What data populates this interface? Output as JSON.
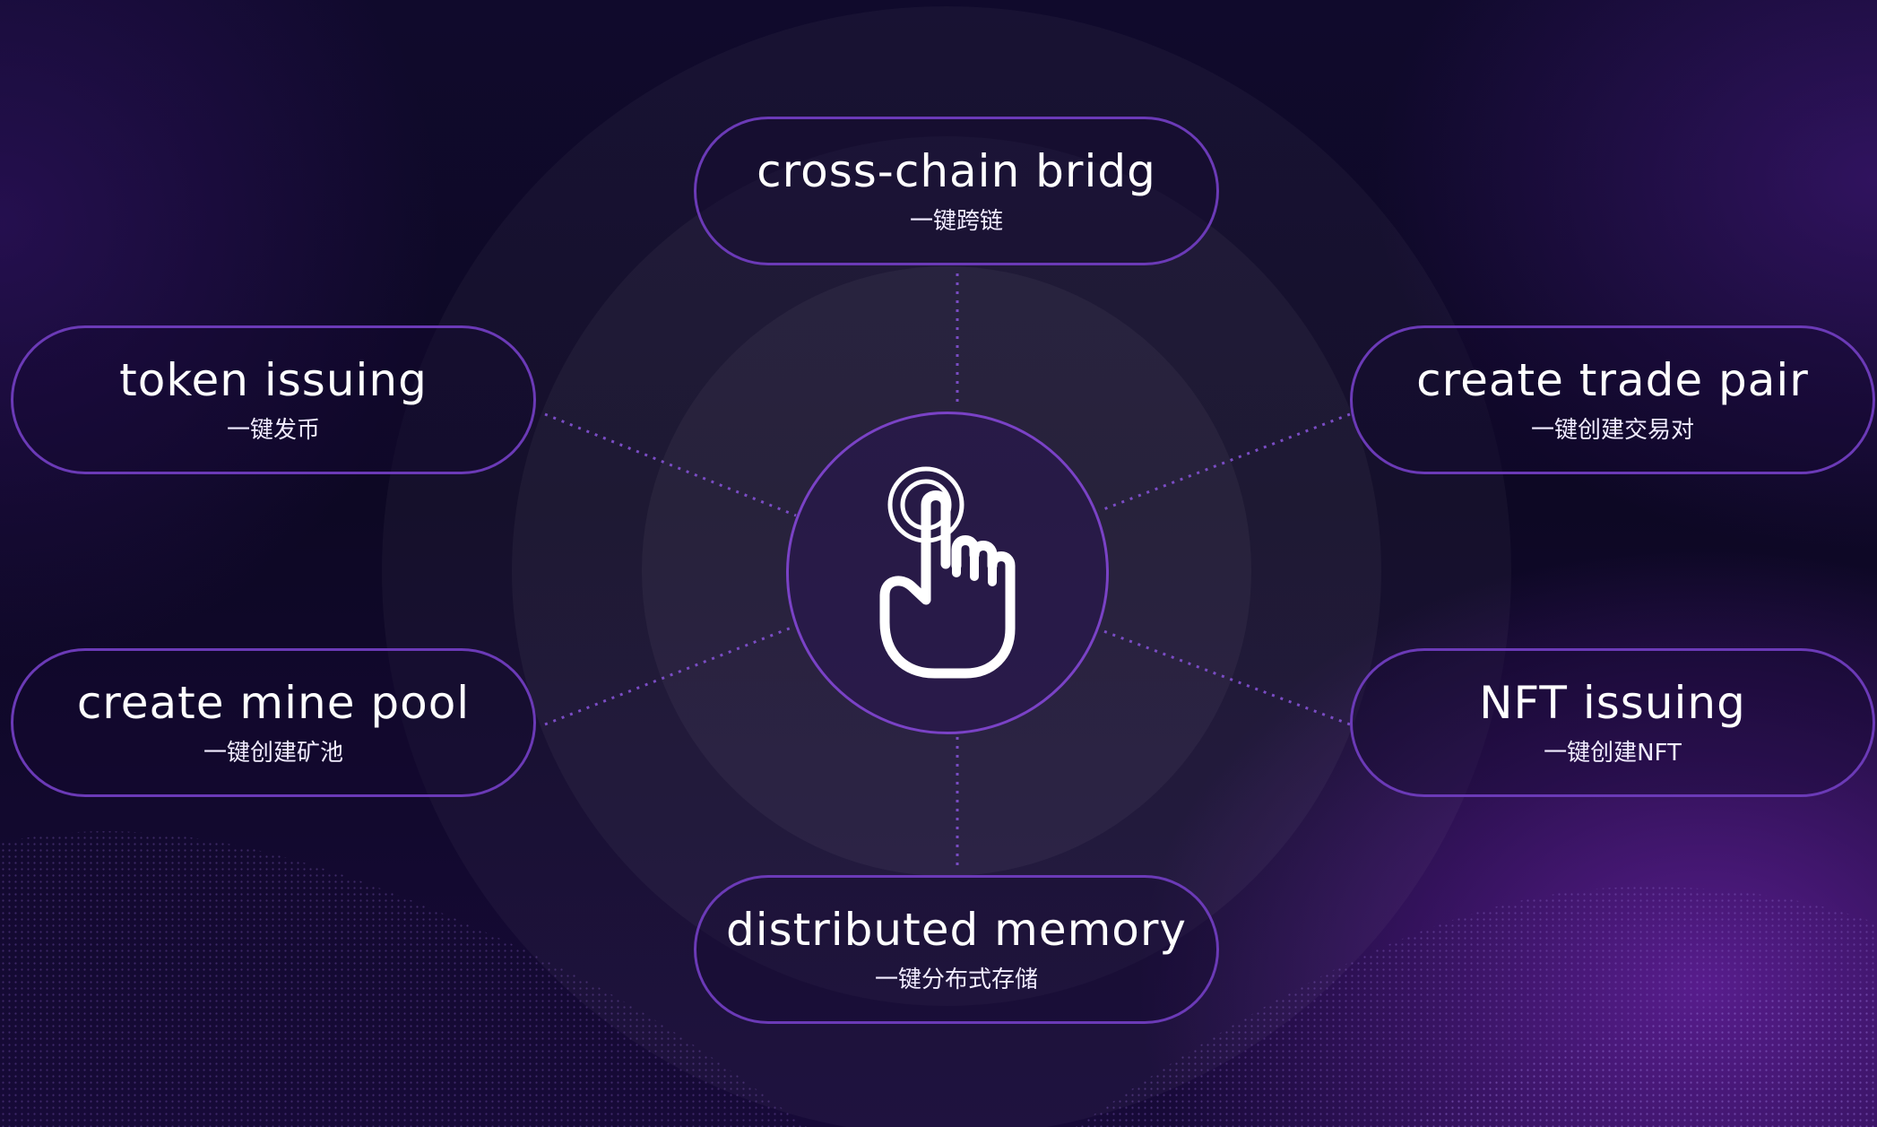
{
  "colors": {
    "accent": "#6b3ab7",
    "background": "#0d0824",
    "text": "#ffffff"
  },
  "center": {
    "icon": "tap-hand-icon"
  },
  "features": {
    "top": {
      "title": "cross-chain bridg",
      "subtitle": "一键跨链"
    },
    "top_left": {
      "title": "token issuing",
      "subtitle": "一键发币"
    },
    "top_right": {
      "title": "create trade pair",
      "subtitle": "一键创建交易对"
    },
    "bottom_left": {
      "title": "create mine pool",
      "subtitle": "一键创建矿池"
    },
    "bottom_right": {
      "title": "NFT issuing",
      "subtitle": "一键创建NFT"
    },
    "bottom": {
      "title": "distributed memory",
      "subtitle": "一键分布式存储"
    }
  }
}
